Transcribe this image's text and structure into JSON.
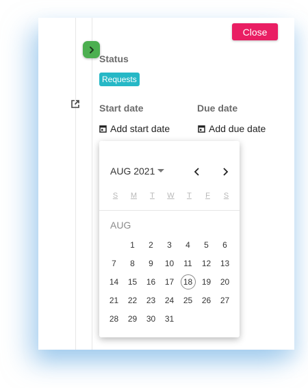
{
  "close_label": "Close",
  "status": {
    "label": "Status",
    "chip": "Requests"
  },
  "dates": {
    "start_label": "Start date",
    "due_label": "Due date",
    "add_start": "Add start date",
    "add_due": "Add due date"
  },
  "picker": {
    "month_year": "AUG 2021",
    "month_caption": "AUG",
    "weekdays": [
      "S",
      "M",
      "T",
      "W",
      "T",
      "F",
      "S"
    ],
    "days": [
      "1",
      "2",
      "3",
      "4",
      "5",
      "6",
      "7",
      "8",
      "9",
      "10",
      "11",
      "12",
      "13",
      "14",
      "15",
      "16",
      "17",
      "18",
      "19",
      "20",
      "21",
      "22",
      "23",
      "24",
      "25",
      "26",
      "27",
      "28",
      "29",
      "30",
      "31"
    ],
    "first_day_column": 1,
    "today": "18"
  },
  "colors": {
    "close": "#e91e63",
    "expand": "#4caf50",
    "chip": "#26b8c6"
  },
  "icons": {
    "expand": "chevron-right-icon",
    "external": "external-link-icon",
    "calendar": "calendar-icon",
    "dropdown": "caret-down-icon",
    "prev": "chevron-left-icon",
    "next": "chevron-right-icon"
  }
}
